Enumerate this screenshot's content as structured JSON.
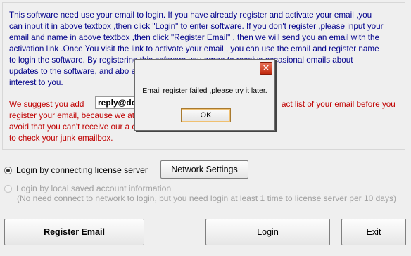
{
  "info": {
    "paragraph": "This software need use your email to login. If you have already register and activate your email ,you\ncan input it in above textbox ,then click \"Login\" to enter software. If you don't register ,please input your\nemail and name in above textbox ,then click \"Register Email\" , then we will send you an email with the\nactivation link .Once You visit the link to activate your email , you can use the email and register name\nto login the software. By registering this software you agree to receive occasional emails about\nupdates to the software, and abo                                                                  e affiliate deem to be of\ninterest to you.",
    "suggest_lead": "We suggest you add",
    "suggest_email": "reply@do",
    "suggest_tail": "act list of your email before you",
    "suggest_rest": "register your email, because we                                                         ation link,  this will be effective to\navoid that  you can't receive our a                                                          e the email ,please remember\nto check your junk emailbox."
  },
  "dialog": {
    "message": "Email register failed ,please try it later.",
    "ok_label": "OK",
    "close_glyph": "✕"
  },
  "options": {
    "server_label": "Login by connecting license server",
    "network_button": "Network Settings",
    "local_label": "Login by local saved account information",
    "local_note": "(No need connect to network to login, but you need login at least  1 time to license server per 10 days)"
  },
  "buttons": {
    "register": "Register Email",
    "login": "Login",
    "exit": "Exit"
  }
}
